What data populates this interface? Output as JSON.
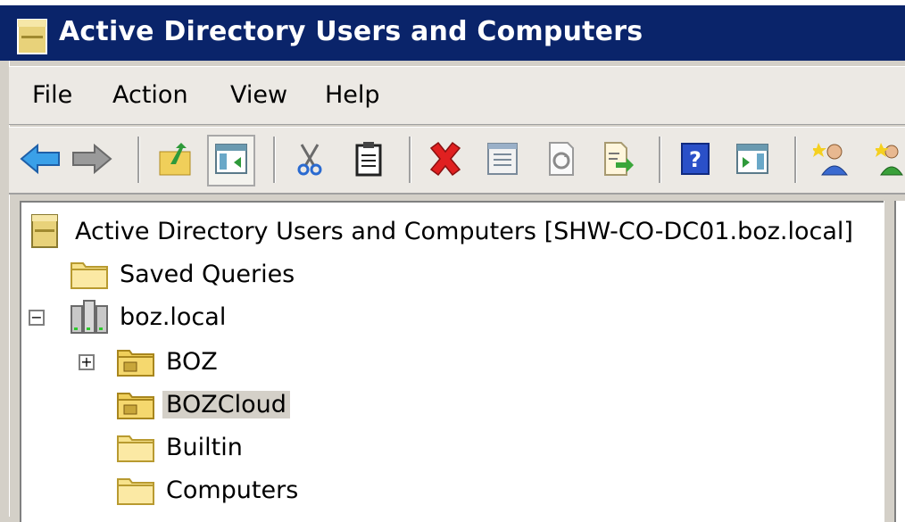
{
  "window": {
    "title": "Active Directory Users and Computers"
  },
  "menu": {
    "items": [
      "File",
      "Action",
      "View",
      "Help"
    ]
  },
  "toolbar": {
    "buttons": [
      {
        "icon": "back-arrow-icon"
      },
      {
        "icon": "forward-arrow-icon"
      },
      {
        "icon": "up-folder-icon"
      },
      {
        "icon": "show-hide-console-tree-icon"
      },
      {
        "icon": "cut-icon"
      },
      {
        "icon": "paste-icon"
      },
      {
        "icon": "delete-icon"
      },
      {
        "icon": "properties-icon"
      },
      {
        "icon": "refresh-icon"
      },
      {
        "icon": "export-list-icon"
      },
      {
        "icon": "help-icon"
      },
      {
        "icon": "show-action-pane-icon"
      },
      {
        "icon": "create-user-icon"
      },
      {
        "icon": "create-group-icon"
      }
    ]
  },
  "tree": {
    "root_label": "Active Directory Users and Computers [SHW-CO-DC01.boz.local]",
    "nodes": [
      {
        "label": "Saved Queries",
        "icon": "folder-icon"
      },
      {
        "label": "boz.local",
        "icon": "domain-icon",
        "expander": "−"
      },
      {
        "label": "BOZ",
        "icon": "ou-folder-icon",
        "expander": "+"
      },
      {
        "label": "BOZCloud",
        "icon": "ou-folder-icon",
        "selected": true
      },
      {
        "label": "Builtin",
        "icon": "folder-icon"
      },
      {
        "label": "Computers",
        "icon": "folder-icon"
      }
    ]
  },
  "colors": {
    "titlebar": "#0a246a",
    "selection": "#d4d0c8",
    "folder": "#f7e28c"
  }
}
